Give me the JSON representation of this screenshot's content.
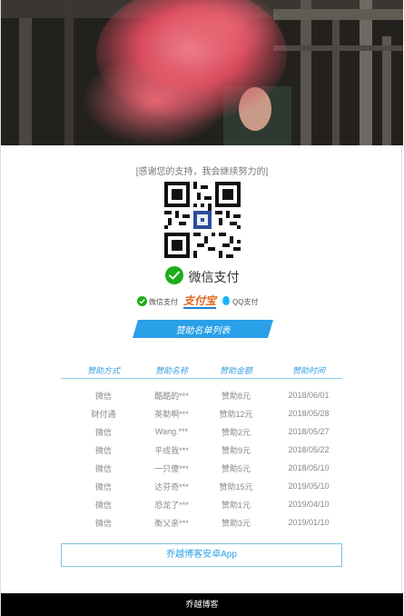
{
  "thanks_text": "[感谢您的支持，我会继续努力的]",
  "wechat_label": "微信支付",
  "pay_options": {
    "wechat": "微信支付",
    "alipay": "支付宝",
    "qq": "QQ支付"
  },
  "sponsor_title": "赞助名单列表",
  "table": {
    "headers": [
      "赞助方式",
      "赞助名称",
      "赞助金额",
      "赞助时间"
    ],
    "rows": [
      [
        "微信",
        "酷酷的***",
        "赞助8元",
        "2018/06/01"
      ],
      [
        "财付通",
        "英勒啊***",
        "赞助12元",
        "2018/05/28"
      ],
      [
        "微信",
        "Wang.***",
        "赞助2元",
        "2018/05/27"
      ],
      [
        "微信",
        "平成我***",
        "赞助9元",
        "2018/05/22"
      ],
      [
        "微信",
        "一只傻***",
        "赞助5元",
        "2018/05/10"
      ],
      [
        "微信",
        "达芬奇***",
        "赞助15元",
        "2019/05/10"
      ],
      [
        "微信",
        "恐龙了***",
        "赞助1元",
        "2019/04/10"
      ],
      [
        "微信",
        "衡父亲***",
        "赞助3元",
        "2019/01/10"
      ]
    ]
  },
  "app_button_label": "乔越博客安卓App",
  "footer_text": "乔越博客",
  "colors": {
    "accent": "#2aa0e8",
    "wechat_green": "#1aad19",
    "footer_bg": "#000000"
  }
}
